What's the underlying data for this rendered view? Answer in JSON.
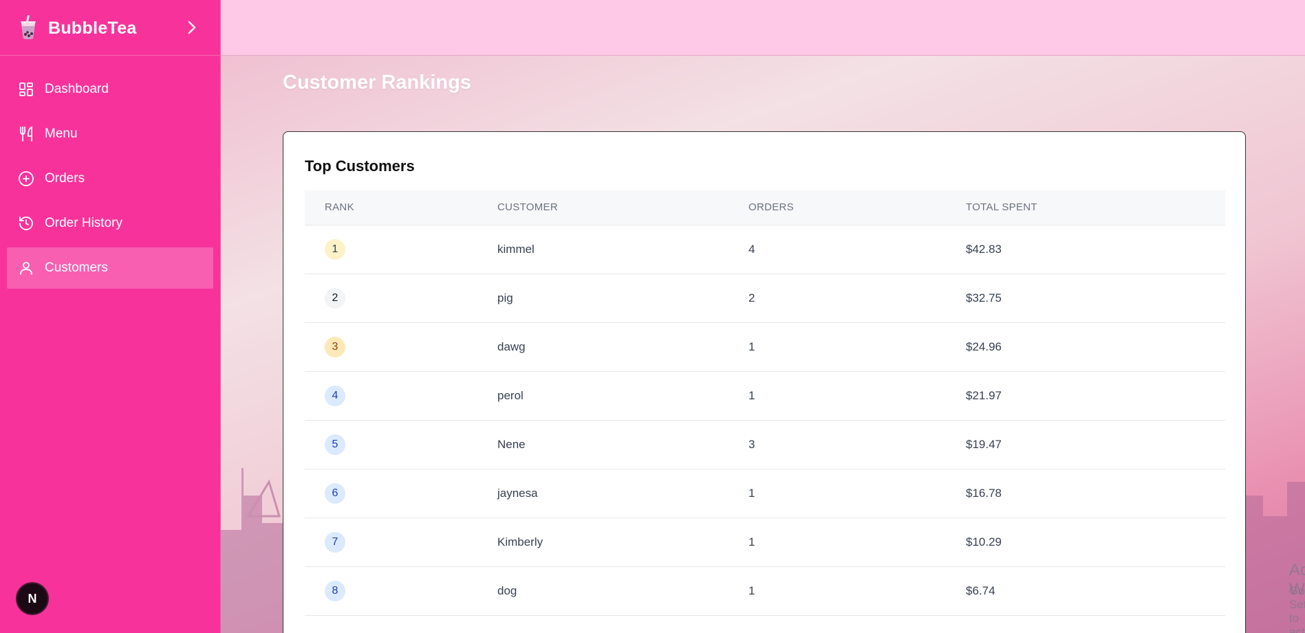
{
  "app": {
    "name": "BubbleTea"
  },
  "sidebar": {
    "items": [
      {
        "label": "Dashboard",
        "icon": "dashboard-icon",
        "active": false
      },
      {
        "label": "Menu",
        "icon": "utensils-icon",
        "active": false
      },
      {
        "label": "Orders",
        "icon": "plus-circle-icon",
        "active": false
      },
      {
        "label": "Order History",
        "icon": "history-icon",
        "active": false
      },
      {
        "label": "Customers",
        "icon": "user-icon",
        "active": true
      }
    ],
    "avatar_letter": "N"
  },
  "page": {
    "title": "Customer Rankings"
  },
  "card": {
    "title": "Top Customers",
    "columns": [
      "RANK",
      "CUSTOMER",
      "ORDERS",
      "TOTAL SPENT"
    ],
    "rows": [
      {
        "rank": "1",
        "customer": "kimmel",
        "orders": "4",
        "total": "$42.83",
        "badge_bg": "#fef3c7",
        "badge_fg": "#374151"
      },
      {
        "rank": "2",
        "customer": "pig",
        "orders": "2",
        "total": "$32.75",
        "badge_bg": "#f3f4f6",
        "badge_fg": "#111827"
      },
      {
        "rank": "3",
        "customer": "dawg",
        "orders": "1",
        "total": "$24.96",
        "badge_bg": "#fde8b8",
        "badge_fg": "#92400e"
      },
      {
        "rank": "4",
        "customer": "perol",
        "orders": "1",
        "total": "$21.97",
        "badge_bg": "#dbeafe",
        "badge_fg": "#1e40af"
      },
      {
        "rank": "5",
        "customer": "Nene",
        "orders": "3",
        "total": "$19.47",
        "badge_bg": "#dbeafe",
        "badge_fg": "#1e40af"
      },
      {
        "rank": "6",
        "customer": "jaynesa",
        "orders": "1",
        "total": "$16.78",
        "badge_bg": "#dbeafe",
        "badge_fg": "#1e40af"
      },
      {
        "rank": "7",
        "customer": "Kimberly",
        "orders": "1",
        "total": "$10.29",
        "badge_bg": "#dbeafe",
        "badge_fg": "#1e40af"
      },
      {
        "rank": "8",
        "customer": "dog",
        "orders": "1",
        "total": "$6.74",
        "badge_bg": "#dbeafe",
        "badge_fg": "#1e40af"
      }
    ]
  },
  "watermark": {
    "line1": "Activate Windows",
    "line2": "Go to Settings to activate Windows."
  },
  "colors": {
    "sidebar": "#f7339b",
    "topbar": "#fdc9e6"
  }
}
